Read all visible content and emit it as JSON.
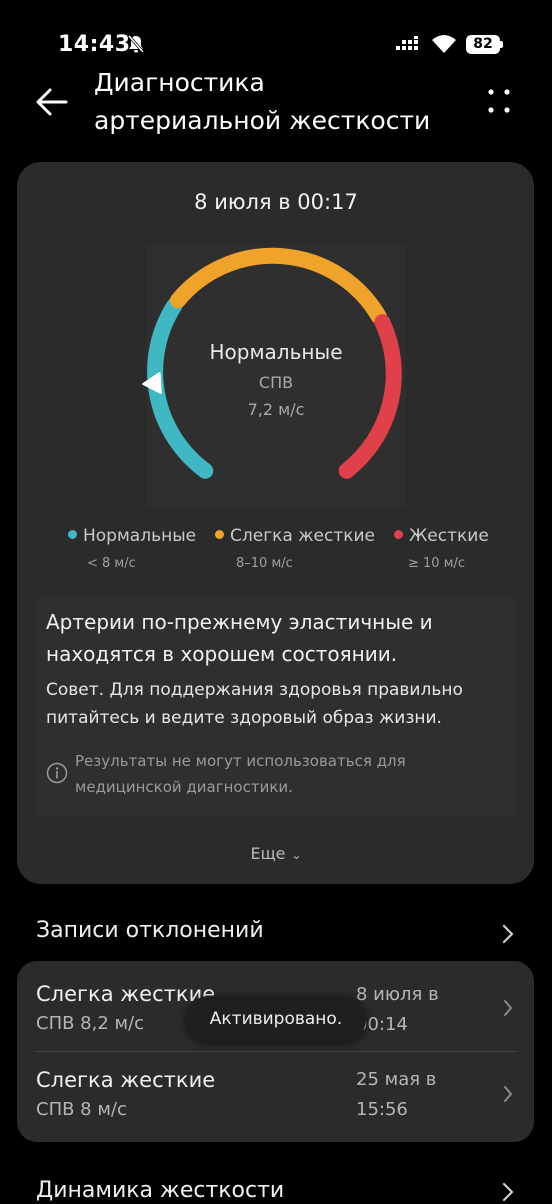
{
  "status_bar": {
    "time": "14:43",
    "battery": "82",
    "icons": [
      "bell-off-icon",
      "signal-icon",
      "wifi-icon",
      "battery-icon"
    ]
  },
  "header": {
    "title": "Диагностика артериальной жесткости",
    "back_icon": "arrow-left-icon",
    "more_icon": "more-vertical-icon"
  },
  "measurement": {
    "date": "8 июля в 00:17",
    "status": "Нормальные",
    "metric": "СПВ",
    "value": "7,2 м/с",
    "gauge_position": 0.18
  },
  "legend": [
    {
      "label": "Нормальные",
      "range": "< 8 м/с",
      "color": "#3fb8c4"
    },
    {
      "label": "Слегка жесткие",
      "range": "8–10 м/с",
      "color": "#efa32a"
    },
    {
      "label": "Жесткие",
      "range": "≥ 10 м/с",
      "color": "#e0404a"
    }
  ],
  "advice": {
    "title": "Артерии по-прежнему эластичные и находятся в хорошем состоянии.",
    "text": "Совет. Для поддержания здоровья правильно питайтесь и ведите здоровый образ жизни.",
    "disclaimer": "Результаты не могут использоваться для медицинской диагностики."
  },
  "more_label": "Еще",
  "deviations": {
    "title": "Записи отклонений",
    "records": [
      {
        "title": "Слегка жесткие",
        "value": "СПВ 8,2 м/с",
        "date": "8 июля в 00:14"
      },
      {
        "title": "Слегка жесткие",
        "value": "СПВ 8 м/с",
        "date": "25 мая в 15:56"
      }
    ]
  },
  "toast": "Активировано.",
  "dynamics": {
    "title": "Динамика жесткости"
  }
}
